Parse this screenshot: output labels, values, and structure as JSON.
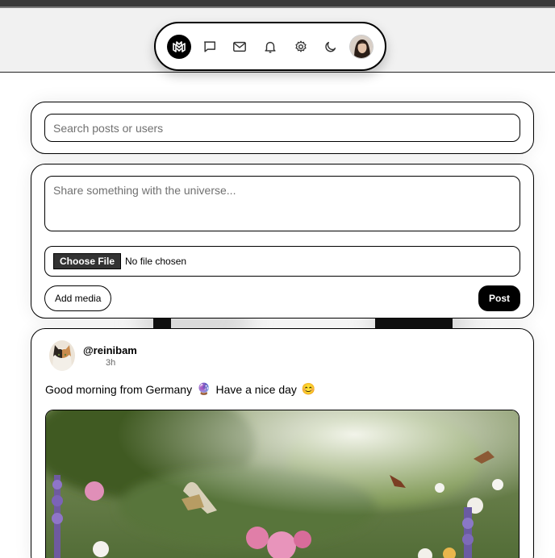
{
  "nav": {
    "items": [
      {
        "name": "logo-icon",
        "label": "Home"
      },
      {
        "name": "chat-bubble-icon",
        "label": "Messages"
      },
      {
        "name": "mail-icon",
        "label": "Mail"
      },
      {
        "name": "bell-icon",
        "label": "Notifications"
      },
      {
        "name": "gear-icon",
        "label": "Settings"
      },
      {
        "name": "moon-icon",
        "label": "Dark mode"
      }
    ]
  },
  "search": {
    "placeholder": "Search posts or users"
  },
  "compose": {
    "placeholder": "Share something with the universe...",
    "choose_file_label": "Choose File",
    "no_file_label": "No file chosen",
    "add_media_label": "Add media",
    "post_label": "Post"
  },
  "feed": {
    "posts": [
      {
        "username": "@reinibam",
        "time": "3h",
        "text": "Good morning from Germany",
        "text_tail": "Have a nice day",
        "emoji_1": "🔮",
        "emoji_2": "😊"
      }
    ]
  },
  "colors": {
    "accent": "#000000",
    "header_bg": "#f1f1f1",
    "page_bg": "#ffffff"
  }
}
